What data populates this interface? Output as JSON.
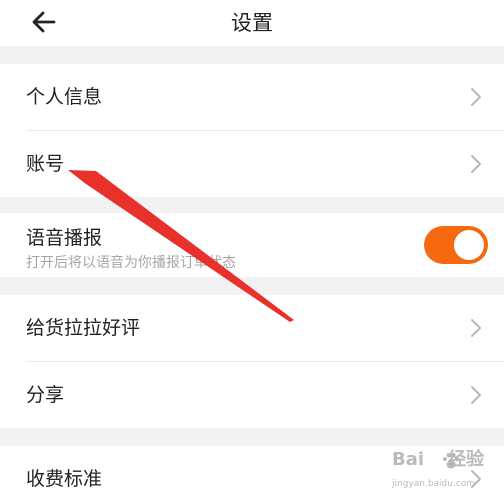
{
  "header": {
    "title": "设置"
  },
  "settings": {
    "personal_info": "个人信息",
    "account": "账号",
    "voice_broadcast": {
      "label": "语音播报",
      "description": "打开后将以语音为你播报订单状态",
      "enabled": true
    },
    "rate_app": "给货拉拉好评",
    "share": "分享",
    "fee_standard": "收费标准"
  },
  "icons": {
    "back": "arrow-left-icon",
    "chevron": "chevron-right-icon"
  },
  "watermark": {
    "brand": "Bai",
    "brand2": "经验",
    "url": "jingyan.baidu.com"
  },
  "colors": {
    "toggle_on": "#f56a10",
    "annotation_arrow": "#e8312a",
    "section_gap": "#f2f2f2"
  }
}
